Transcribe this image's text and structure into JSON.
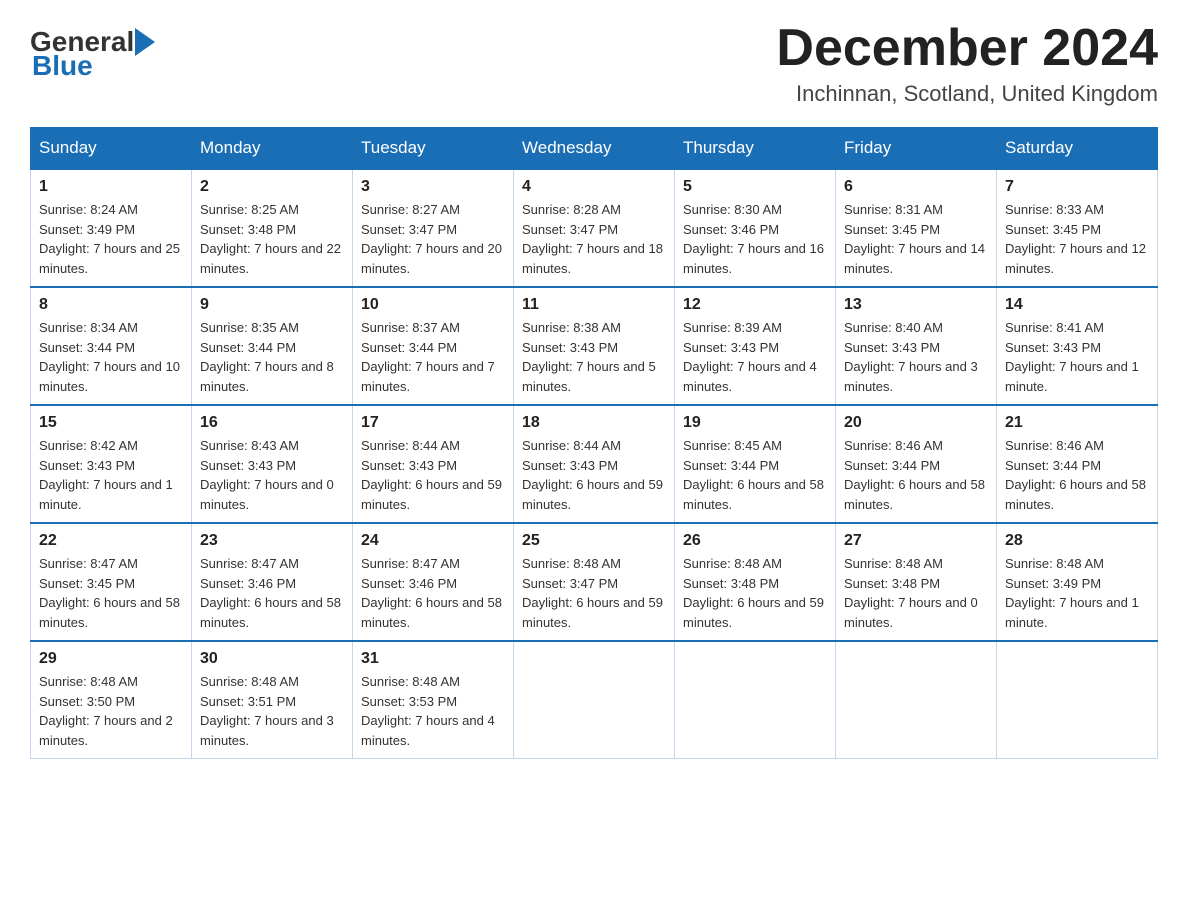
{
  "logo": {
    "general": "General",
    "blue": "Blue"
  },
  "title": "December 2024",
  "location": "Inchinnan, Scotland, United Kingdom",
  "weekdays": [
    "Sunday",
    "Monday",
    "Tuesday",
    "Wednesday",
    "Thursday",
    "Friday",
    "Saturday"
  ],
  "weeks": [
    [
      {
        "day": "1",
        "sunrise": "Sunrise: 8:24 AM",
        "sunset": "Sunset: 3:49 PM",
        "daylight": "Daylight: 7 hours and 25 minutes."
      },
      {
        "day": "2",
        "sunrise": "Sunrise: 8:25 AM",
        "sunset": "Sunset: 3:48 PM",
        "daylight": "Daylight: 7 hours and 22 minutes."
      },
      {
        "day": "3",
        "sunrise": "Sunrise: 8:27 AM",
        "sunset": "Sunset: 3:47 PM",
        "daylight": "Daylight: 7 hours and 20 minutes."
      },
      {
        "day": "4",
        "sunrise": "Sunrise: 8:28 AM",
        "sunset": "Sunset: 3:47 PM",
        "daylight": "Daylight: 7 hours and 18 minutes."
      },
      {
        "day": "5",
        "sunrise": "Sunrise: 8:30 AM",
        "sunset": "Sunset: 3:46 PM",
        "daylight": "Daylight: 7 hours and 16 minutes."
      },
      {
        "day": "6",
        "sunrise": "Sunrise: 8:31 AM",
        "sunset": "Sunset: 3:45 PM",
        "daylight": "Daylight: 7 hours and 14 minutes."
      },
      {
        "day": "7",
        "sunrise": "Sunrise: 8:33 AM",
        "sunset": "Sunset: 3:45 PM",
        "daylight": "Daylight: 7 hours and 12 minutes."
      }
    ],
    [
      {
        "day": "8",
        "sunrise": "Sunrise: 8:34 AM",
        "sunset": "Sunset: 3:44 PM",
        "daylight": "Daylight: 7 hours and 10 minutes."
      },
      {
        "day": "9",
        "sunrise": "Sunrise: 8:35 AM",
        "sunset": "Sunset: 3:44 PM",
        "daylight": "Daylight: 7 hours and 8 minutes."
      },
      {
        "day": "10",
        "sunrise": "Sunrise: 8:37 AM",
        "sunset": "Sunset: 3:44 PM",
        "daylight": "Daylight: 7 hours and 7 minutes."
      },
      {
        "day": "11",
        "sunrise": "Sunrise: 8:38 AM",
        "sunset": "Sunset: 3:43 PM",
        "daylight": "Daylight: 7 hours and 5 minutes."
      },
      {
        "day": "12",
        "sunrise": "Sunrise: 8:39 AM",
        "sunset": "Sunset: 3:43 PM",
        "daylight": "Daylight: 7 hours and 4 minutes."
      },
      {
        "day": "13",
        "sunrise": "Sunrise: 8:40 AM",
        "sunset": "Sunset: 3:43 PM",
        "daylight": "Daylight: 7 hours and 3 minutes."
      },
      {
        "day": "14",
        "sunrise": "Sunrise: 8:41 AM",
        "sunset": "Sunset: 3:43 PM",
        "daylight": "Daylight: 7 hours and 1 minute."
      }
    ],
    [
      {
        "day": "15",
        "sunrise": "Sunrise: 8:42 AM",
        "sunset": "Sunset: 3:43 PM",
        "daylight": "Daylight: 7 hours and 1 minute."
      },
      {
        "day": "16",
        "sunrise": "Sunrise: 8:43 AM",
        "sunset": "Sunset: 3:43 PM",
        "daylight": "Daylight: 7 hours and 0 minutes."
      },
      {
        "day": "17",
        "sunrise": "Sunrise: 8:44 AM",
        "sunset": "Sunset: 3:43 PM",
        "daylight": "Daylight: 6 hours and 59 minutes."
      },
      {
        "day": "18",
        "sunrise": "Sunrise: 8:44 AM",
        "sunset": "Sunset: 3:43 PM",
        "daylight": "Daylight: 6 hours and 59 minutes."
      },
      {
        "day": "19",
        "sunrise": "Sunrise: 8:45 AM",
        "sunset": "Sunset: 3:44 PM",
        "daylight": "Daylight: 6 hours and 58 minutes."
      },
      {
        "day": "20",
        "sunrise": "Sunrise: 8:46 AM",
        "sunset": "Sunset: 3:44 PM",
        "daylight": "Daylight: 6 hours and 58 minutes."
      },
      {
        "day": "21",
        "sunrise": "Sunrise: 8:46 AM",
        "sunset": "Sunset: 3:44 PM",
        "daylight": "Daylight: 6 hours and 58 minutes."
      }
    ],
    [
      {
        "day": "22",
        "sunrise": "Sunrise: 8:47 AM",
        "sunset": "Sunset: 3:45 PM",
        "daylight": "Daylight: 6 hours and 58 minutes."
      },
      {
        "day": "23",
        "sunrise": "Sunrise: 8:47 AM",
        "sunset": "Sunset: 3:46 PM",
        "daylight": "Daylight: 6 hours and 58 minutes."
      },
      {
        "day": "24",
        "sunrise": "Sunrise: 8:47 AM",
        "sunset": "Sunset: 3:46 PM",
        "daylight": "Daylight: 6 hours and 58 minutes."
      },
      {
        "day": "25",
        "sunrise": "Sunrise: 8:48 AM",
        "sunset": "Sunset: 3:47 PM",
        "daylight": "Daylight: 6 hours and 59 minutes."
      },
      {
        "day": "26",
        "sunrise": "Sunrise: 8:48 AM",
        "sunset": "Sunset: 3:48 PM",
        "daylight": "Daylight: 6 hours and 59 minutes."
      },
      {
        "day": "27",
        "sunrise": "Sunrise: 8:48 AM",
        "sunset": "Sunset: 3:48 PM",
        "daylight": "Daylight: 7 hours and 0 minutes."
      },
      {
        "day": "28",
        "sunrise": "Sunrise: 8:48 AM",
        "sunset": "Sunset: 3:49 PM",
        "daylight": "Daylight: 7 hours and 1 minute."
      }
    ],
    [
      {
        "day": "29",
        "sunrise": "Sunrise: 8:48 AM",
        "sunset": "Sunset: 3:50 PM",
        "daylight": "Daylight: 7 hours and 2 minutes."
      },
      {
        "day": "30",
        "sunrise": "Sunrise: 8:48 AM",
        "sunset": "Sunset: 3:51 PM",
        "daylight": "Daylight: 7 hours and 3 minutes."
      },
      {
        "day": "31",
        "sunrise": "Sunrise: 8:48 AM",
        "sunset": "Sunset: 3:53 PM",
        "daylight": "Daylight: 7 hours and 4 minutes."
      },
      null,
      null,
      null,
      null
    ]
  ]
}
